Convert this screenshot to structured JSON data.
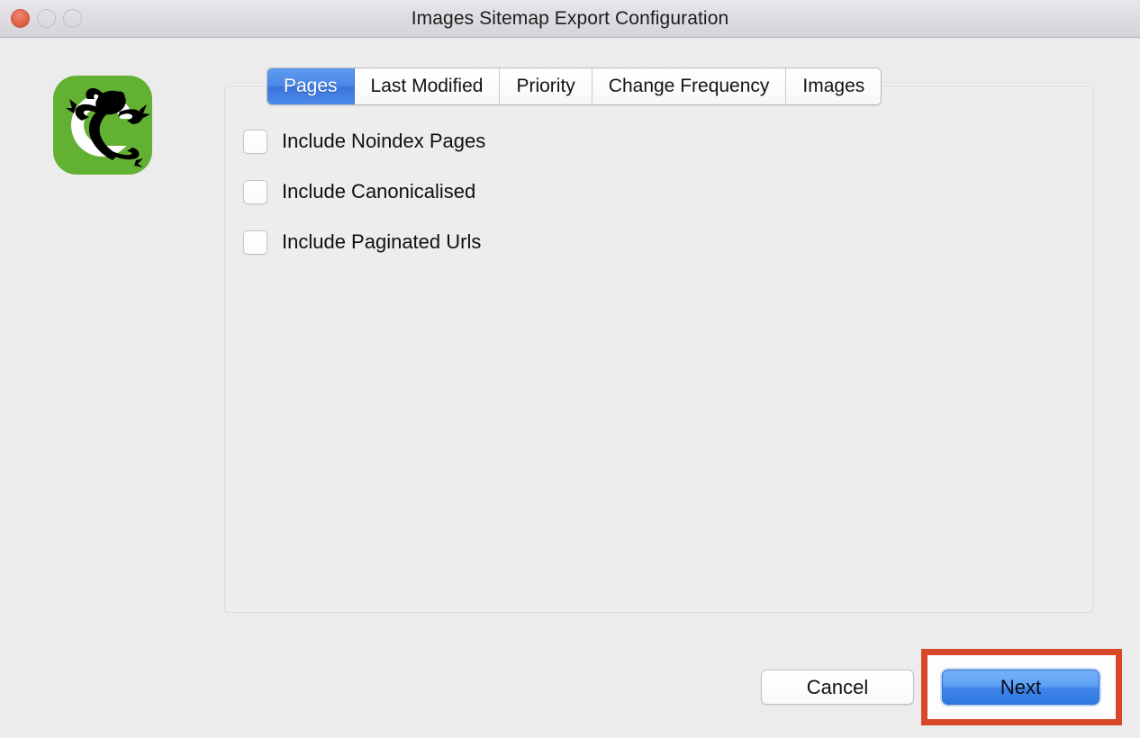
{
  "window": {
    "title": "Images Sitemap Export Configuration",
    "controls": [
      {
        "name": "close",
        "icon": "close-traffic-light"
      },
      {
        "name": "minimize",
        "icon": "minimize-traffic-light"
      },
      {
        "name": "maximize",
        "icon": "maximize-traffic-light"
      }
    ]
  },
  "logo": {
    "icon": "screaming-frog-logo",
    "background_color": "#63b132",
    "frog_color": "#000000"
  },
  "tabs": [
    {
      "label": "Pages",
      "selected": true
    },
    {
      "label": "Last Modified",
      "selected": false
    },
    {
      "label": "Priority",
      "selected": false
    },
    {
      "label": "Change Frequency",
      "selected": false
    },
    {
      "label": "Images",
      "selected": false
    }
  ],
  "options": [
    {
      "label": "Include Noindex Pages",
      "checked": false
    },
    {
      "label": "Include Canonicalised",
      "checked": false
    },
    {
      "label": "Include Paginated Urls",
      "checked": false
    }
  ],
  "footer": {
    "cancel_label": "Cancel",
    "next_label": "Next"
  },
  "colors": {
    "accent_blue": "#4b88e8",
    "highlight_red": "#d9472b",
    "window_background": "#ececec",
    "panel_background": "#ededed"
  }
}
